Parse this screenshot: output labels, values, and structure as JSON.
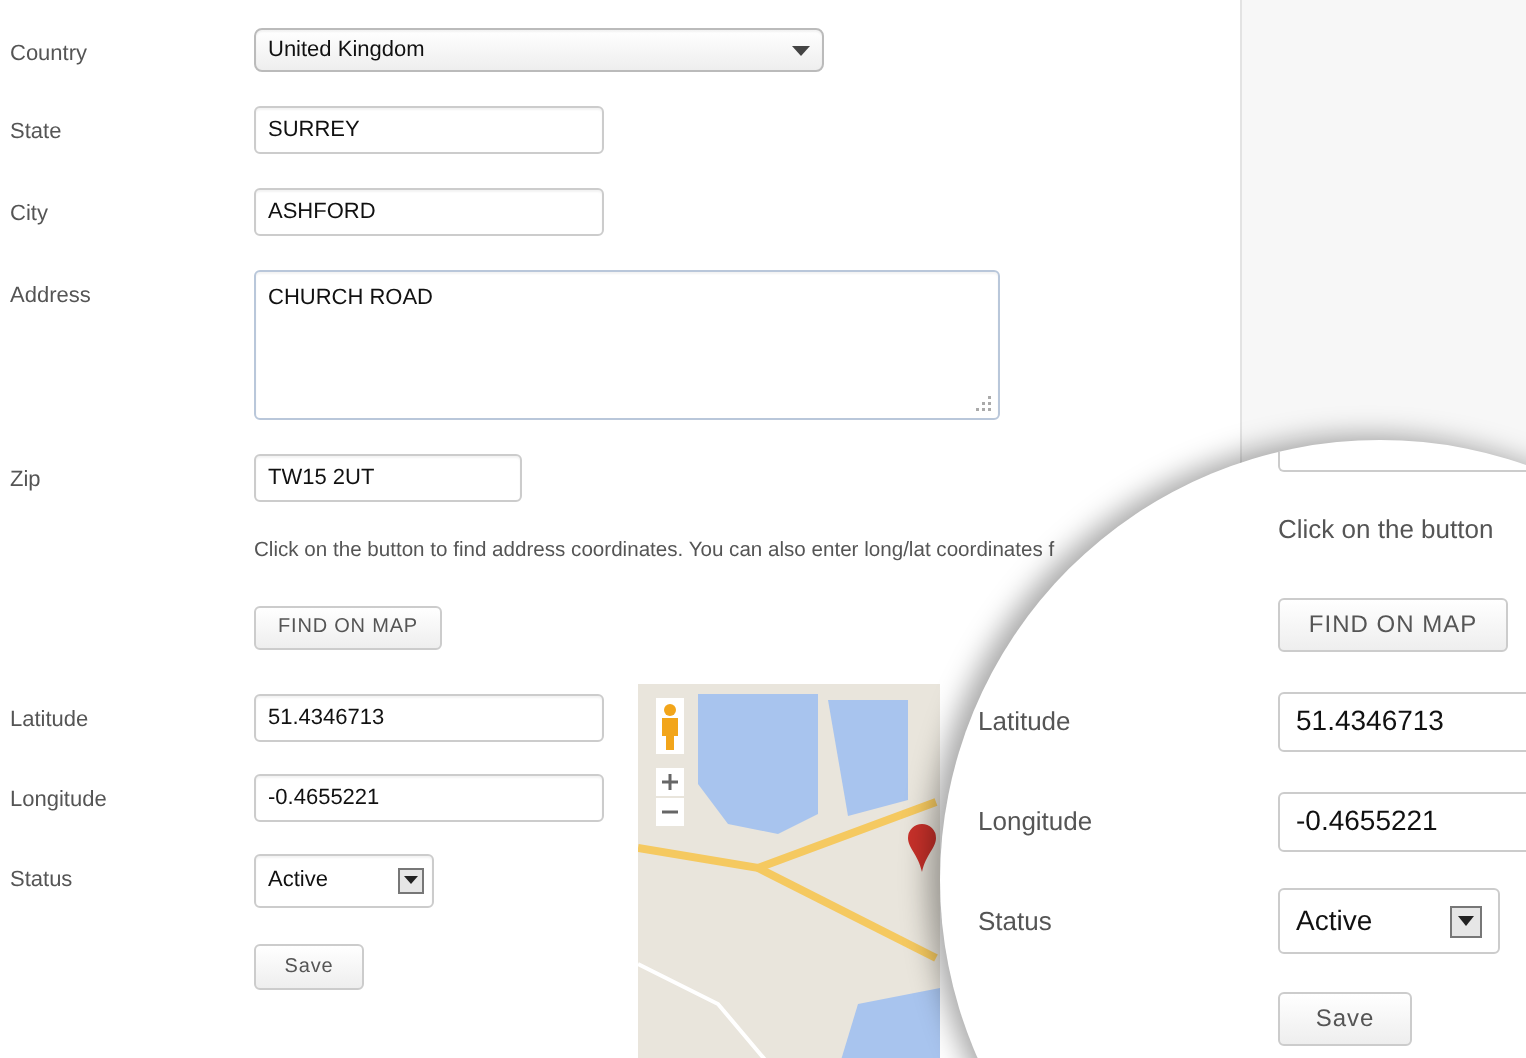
{
  "form": {
    "fields": [
      {
        "label": "Country",
        "kind": "select",
        "value": "United Kingdom"
      },
      {
        "label": "State",
        "kind": "text",
        "value": "SURREY"
      },
      {
        "label": "City",
        "kind": "text",
        "value": "ASHFORD"
      },
      {
        "label": "Address",
        "kind": "textarea",
        "value": "CHURCH ROAD"
      },
      {
        "label": "Zip",
        "kind": "text",
        "value": "TW15 2UT"
      }
    ],
    "help_text": "Click on the button to find address coordinates. You can also enter long/lat coordinates f",
    "find_button": "FIND ON MAP",
    "coordinate_fields": [
      {
        "label": "Latitude",
        "kind": "text",
        "value": "51.4346713"
      },
      {
        "label": "Longitude",
        "kind": "text",
        "value": "-0.4655221"
      },
      {
        "label": "Status",
        "kind": "combo",
        "value": "Active"
      }
    ],
    "save_button": "Save"
  },
  "magnifier": {
    "help_text": "Click on the button",
    "find_button": "FIND ON MAP",
    "fields": [
      {
        "label": "Latitude",
        "kind": "text",
        "value": "51.4346713"
      },
      {
        "label": "Longitude",
        "kind": "text",
        "value": "-0.4655221"
      },
      {
        "label": "Status",
        "kind": "combo",
        "value": "Active"
      }
    ],
    "save_button": "Save"
  }
}
